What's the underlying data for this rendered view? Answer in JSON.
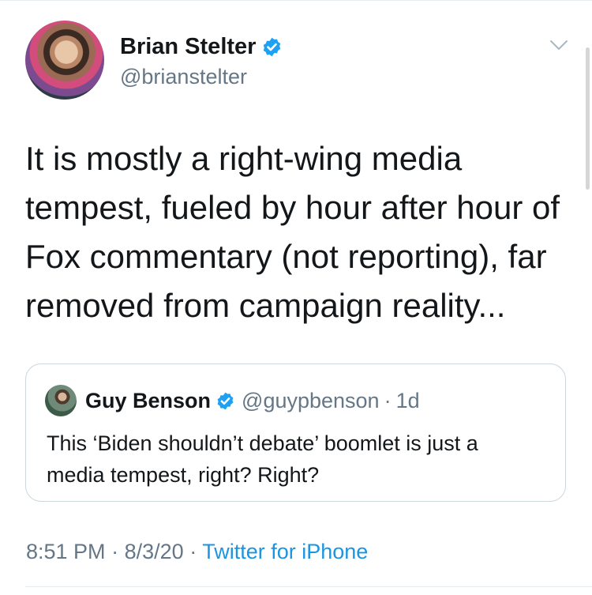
{
  "tweet": {
    "author_name": "Brian Stelter",
    "author_handle": "@brianstelter",
    "text_lines": [
      "It is mostly a right-wing media",
      "tempest, fueled by hour after hour of",
      "Fox commentary (not reporting), far",
      "removed from campaign reality..."
    ],
    "time": "8:51 PM",
    "date": "8/3/20",
    "source": "Twitter for iPhone",
    "separator": "·"
  },
  "quoted_tweet": {
    "author_name": "Guy Benson",
    "author_handle": "@guypbenson",
    "separator": "·",
    "age": "1d",
    "text_lines": [
      "This ‘Biden shouldn’t debate’ boomlet is just a",
      "media tempest, right? Right?"
    ]
  },
  "icons": {
    "verified": "verified-badge-icon",
    "menu": "chevron-down-icon"
  },
  "colors": {
    "accent": "#1da1f2",
    "link": "#1b95e0",
    "secondary_text": "#657786",
    "primary_text": "#14171a",
    "border": "#ccd6dd"
  }
}
